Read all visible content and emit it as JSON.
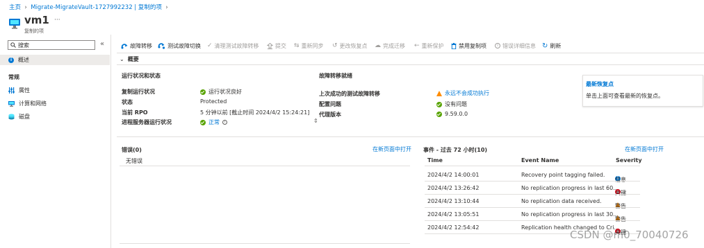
{
  "breadcrumb": {
    "home": "主页",
    "vault": "Migrate-MigrateVault-1727992232 | 复制的项"
  },
  "header": {
    "title": "vm1",
    "subtitle": "复制的项",
    "more": "···"
  },
  "sidebar": {
    "search_placeholder": "搜索",
    "collapse": "«",
    "overview": "概述",
    "section_general": "常规",
    "items": [
      {
        "label": "属性",
        "icon": "properties-icon"
      },
      {
        "label": "计算和网络",
        "icon": "compute-network-icon"
      },
      {
        "label": "磁盘",
        "icon": "disk-icon"
      }
    ]
  },
  "toolbar": {
    "failover": "故障转移",
    "test_failover": "测试故障切换",
    "cleanup_test": "清理测试故障转移",
    "commit": "提交",
    "resync": "重新同步",
    "change_recovery_point": "更改恢复点",
    "complete_migration": "完成迁移",
    "reprotect": "重新保护",
    "disable_replication": "禁用复制项",
    "error_details": "错误详细信息",
    "refresh": "刷新"
  },
  "essentials": {
    "title": "概要"
  },
  "health": {
    "title": "运行状况和状态",
    "rows": [
      {
        "label": "复制运行状况",
        "value": "运行状况良好"
      },
      {
        "label": "状态",
        "value": "Protected"
      },
      {
        "label": "当前 RPO",
        "value": "5 分钟以前 [截止时间 2024/4/2 15:24:21]"
      },
      {
        "label": "进程服务器运行状况",
        "value": "正常"
      }
    ]
  },
  "failover_ready": {
    "title": "故障转移就绪",
    "rows": [
      {
        "label": "上次成功的测试故障转移",
        "value": "永远不会成功执行"
      },
      {
        "label": "配置问题",
        "value": "没有问题"
      },
      {
        "label": "代理版本",
        "value": "9.59.0.0"
      }
    ]
  },
  "latest_recovery": {
    "title": "最新恢复点",
    "text": "单击上面可查看最新的恢复点。"
  },
  "errors": {
    "title": "错误(0)",
    "open_link": "在新页面中打开",
    "empty": "无错误"
  },
  "events": {
    "title": "事件 - 过去 72 小时(10)",
    "open_link": "在新页面中打开",
    "columns": [
      "Time",
      "Event Name",
      "Severity"
    ],
    "rows": [
      {
        "time": "2024/4/2 14:00:01",
        "name": "Recovery point tagging failed.",
        "severity": "信息",
        "level": "info"
      },
      {
        "time": "2024/4/2 13:26:42",
        "name": "No replication progress in last 60...",
        "severity": "关键",
        "level": "critical"
      },
      {
        "time": "2024/4/2 13:10:44",
        "name": "No replication data received.",
        "severity": "警告",
        "level": "warning"
      },
      {
        "time": "2024/4/2 13:05:51",
        "name": "No replication progress in last 30...",
        "severity": "警告",
        "level": "warning"
      },
      {
        "time": "2024/4/2 12:54:42",
        "name": "Replication health changed to Cri...",
        "severity": "关键",
        "level": "critical"
      }
    ]
  },
  "watermark": "CSDN @m0_70040726",
  "colors": {
    "accent": "#0078d4",
    "success": "#57a300",
    "warning": "#ff8c00",
    "error": "#e00b1c"
  }
}
